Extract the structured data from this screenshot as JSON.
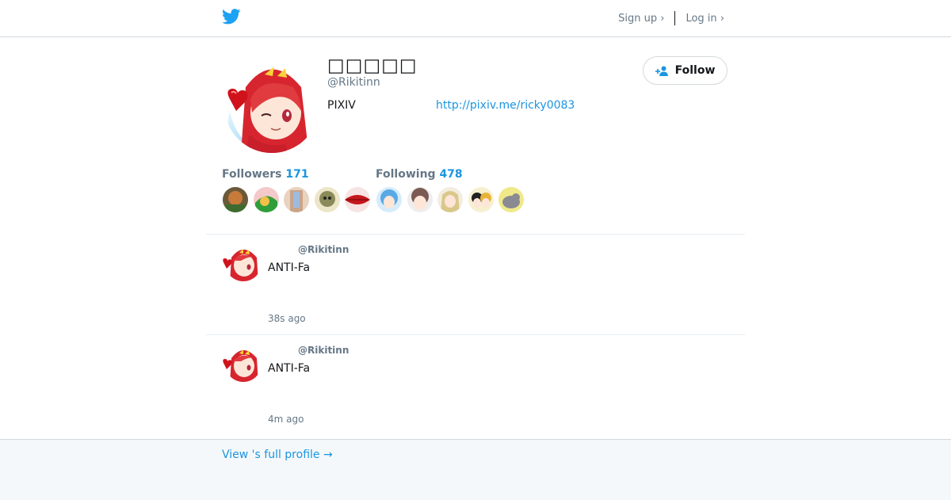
{
  "header": {
    "logo_icon": "twitter-bird-icon",
    "signup_label": "Sign up ›",
    "login_label": "Log in ›"
  },
  "profile": {
    "display_name": "□□□□□",
    "handle": "@Rikitinn",
    "bio": "PIXIV",
    "link": "http://pixiv.me/ricky0083",
    "follow_label": "Follow",
    "follow_icon": "add-user-icon"
  },
  "stats": {
    "followers_label": "Followers",
    "followers_count": "171",
    "following_label": "Following",
    "following_count": "478"
  },
  "tweets": [
    {
      "handle": "@Rikitinn",
      "text": "ANTI-Fa",
      "time": "38s ago"
    },
    {
      "handle": "@Rikitinn",
      "text": "ANTI-Fa",
      "time": "4m ago"
    }
  ],
  "footer": {
    "full_profile_label": "View 's full profile →"
  },
  "colors": {
    "accent": "#1b95e0",
    "brand": "#1da1f2",
    "muted": "#657786",
    "border": "#e6ecf0"
  }
}
